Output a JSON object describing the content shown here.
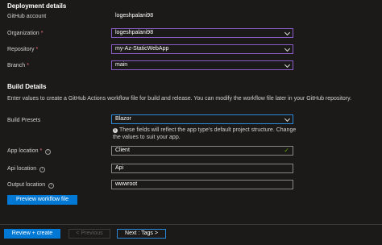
{
  "deployment": {
    "title": "Deployment details",
    "github_account_label": "GitHub account",
    "github_account_value": "logeshpalani98",
    "organization_label": "Organization",
    "organization_value": "logeshpalani98",
    "repository_label": "Repository",
    "repository_value": "my-Az-StaticWebApp",
    "branch_label": "Branch",
    "branch_value": "main",
    "required_mark": "*"
  },
  "build": {
    "title": "Build Details",
    "description": "Enter values to create a GitHub Actions workflow file for build and release. You can modify the workflow file later in your GitHub repository.",
    "presets_label": "Build Presets",
    "presets_value": "Blazor",
    "presets_note": "These fields will reflect the app type's default project structure. Change the values to suit your app.",
    "app_location_label": "App location",
    "app_location_value": "Client",
    "api_location_label": "Api location",
    "api_location_value": "Api",
    "output_location_label": "Output location",
    "output_location_value": "wwwroot",
    "preview_button": "Preview workflow file"
  },
  "footer": {
    "review_create": "Review + create",
    "previous": "< Previous",
    "next": "Next : Tags >"
  },
  "icons": {
    "info": "info-icon",
    "check": "checkmark-icon",
    "chevron": "chevron-down-icon"
  },
  "colors": {
    "background": "#1b1a19",
    "accent": "#0078d4",
    "required": "#f1707b",
    "valid": "#57a300",
    "focus_border": "#8a5cc8"
  }
}
